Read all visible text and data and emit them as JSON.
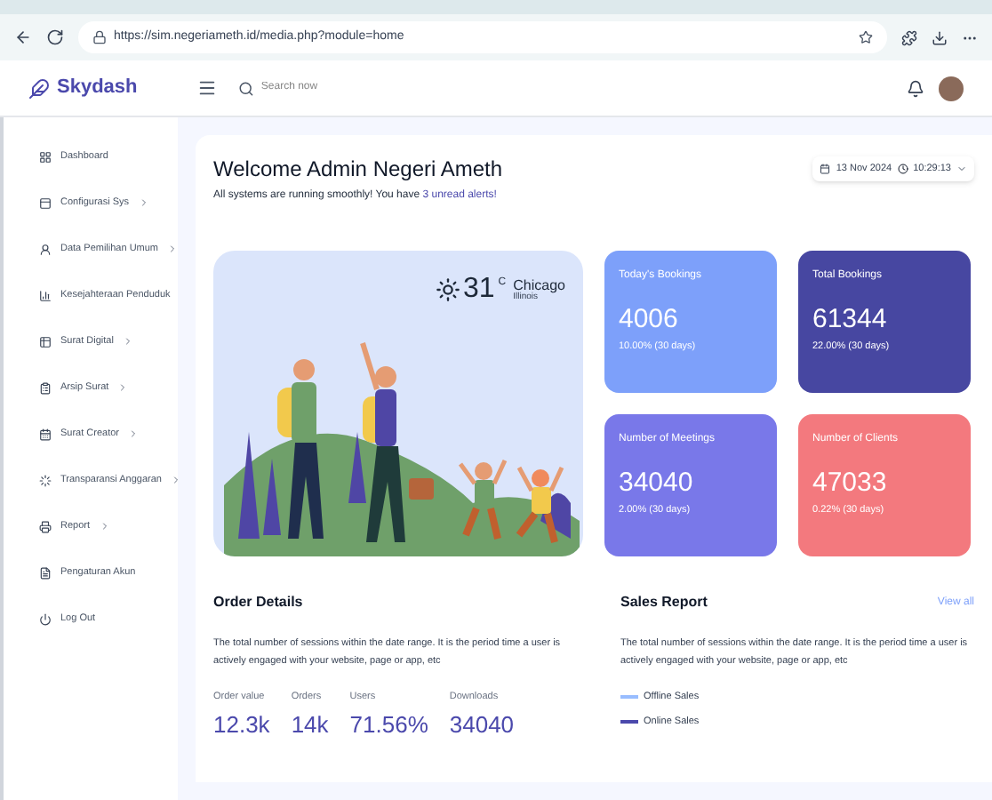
{
  "browser": {
    "url": "https://sim.negeriameth.id/media.php?module=home"
  },
  "header": {
    "brand": "Skydash",
    "search_placeholder": "Search now"
  },
  "sidebar": {
    "items": [
      {
        "label": "Dashboard",
        "has_submenu": false
      },
      {
        "label": "Configurasi Sys",
        "has_submenu": true
      },
      {
        "label": "Data Pemilihan Umum",
        "has_submenu": true
      },
      {
        "label": "Kesejahteraan Penduduk",
        "has_submenu": false
      },
      {
        "label": "Surat Digital",
        "has_submenu": true
      },
      {
        "label": "Arsip Surat",
        "has_submenu": true
      },
      {
        "label": "Surat Creator",
        "has_submenu": true
      },
      {
        "label": "Transparansi Anggaran",
        "has_submenu": true
      },
      {
        "label": "Report",
        "has_submenu": true
      },
      {
        "label": "Pengaturan Akun",
        "has_submenu": false
      },
      {
        "label": "Log Out",
        "has_submenu": false
      }
    ]
  },
  "welcome": {
    "title": "Welcome Admin Negeri Ameth",
    "message": "All systems are running smoothly! You have ",
    "alert_link": "3 unread alerts!",
    "date": "13 Nov 2024",
    "time": "10:29:13"
  },
  "weather": {
    "temperature": "31",
    "unit": "C",
    "city": "Chicago",
    "region": "Illinois"
  },
  "stat_cards": [
    {
      "title": "Today's Bookings",
      "value": "4006",
      "change": "10.00% (30 days)",
      "color": "#7da0fa"
    },
    {
      "title": "Total Bookings",
      "value": "61344",
      "change": "22.00% (30 days)",
      "color": "#4747a1"
    },
    {
      "title": "Number of Meetings",
      "value": "34040",
      "change": "2.00% (30 days)",
      "color": "#7978e9"
    },
    {
      "title": "Number of Clients",
      "value": "47033",
      "change": "0.22% (30 days)",
      "color": "#f3797e"
    }
  ],
  "order_details": {
    "title": "Order Details",
    "description": "The total number of sessions within the date range. It is the period time a user is actively engaged with your website, page or app, etc",
    "stats": [
      {
        "label": "Order value",
        "value": "12.3k"
      },
      {
        "label": "Orders",
        "value": "14k"
      },
      {
        "label": "Users",
        "value": "71.56%"
      },
      {
        "label": "Downloads",
        "value": "34040"
      }
    ]
  },
  "sales_report": {
    "title": "Sales Report",
    "link": "View all",
    "description": "The total number of sessions within the date range. It is the period time a user is actively engaged with your website, page or app, etc",
    "legend": [
      {
        "label": "Offline Sales",
        "color": "#98bdff"
      },
      {
        "label": "Online Sales",
        "color": "#4b49ac"
      }
    ]
  }
}
